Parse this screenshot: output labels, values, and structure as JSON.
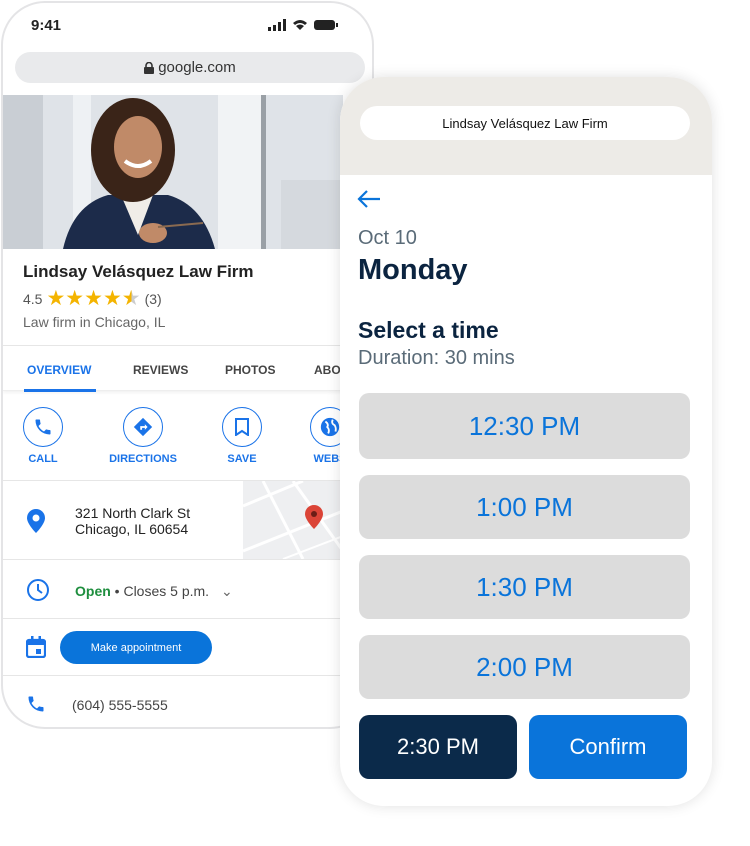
{
  "left_phone": {
    "status_time": "9:41",
    "url": "google.com",
    "business_name": "Lindsay Velásquez Law Firm",
    "rating": "4.5",
    "rating_value": 4.5,
    "review_count": "(3)",
    "category": "Law firm in Chicago, IL",
    "tabs": [
      {
        "label": "OVERVIEW",
        "active": true
      },
      {
        "label": "REVIEWS"
      },
      {
        "label": "PHOTOS"
      },
      {
        "label": "ABO"
      }
    ],
    "actions": [
      {
        "label": "CALL",
        "icon": "phone-icon"
      },
      {
        "label": "DIRECTIONS",
        "icon": "directions-icon"
      },
      {
        "label": "SAVE",
        "icon": "bookmark-icon"
      },
      {
        "label": "WEBS",
        "icon": "globe-icon"
      }
    ],
    "address_line1": "321 North Clark St",
    "address_line2": "Chicago, IL 60654",
    "hours_open": "Open",
    "hours_rest": " • Closes 5 p.m.",
    "appointment_button": "Make appointment",
    "phone": "(604) 555-5555"
  },
  "right_phone": {
    "header_title": "Lindsay Velásquez Law Firm",
    "date": "Oct 10",
    "day": "Monday",
    "heading": "Select a time",
    "duration": "Duration: 30 mins",
    "slots": [
      "12:30 PM",
      "1:00 PM",
      "1:30 PM",
      "2:00 PM"
    ],
    "selected_slot": "2:30 PM",
    "confirm_label": "Confirm"
  },
  "colors": {
    "accent": "#0a74da",
    "google_blue": "#1a73e8",
    "navy": "#0b2a4a",
    "star": "#f4b400",
    "open": "#1e8e3e",
    "slot_bg": "#dcdcdc"
  }
}
